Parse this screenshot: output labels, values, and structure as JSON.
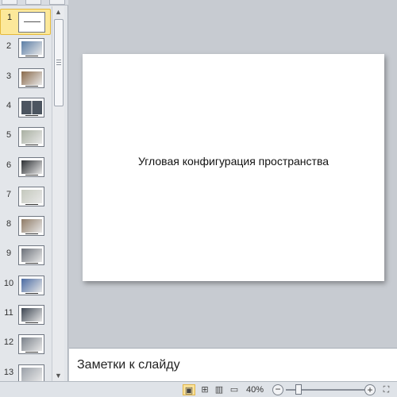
{
  "thumbnails": [
    {
      "number": "1",
      "selected": true,
      "kind": "title"
    },
    {
      "number": "2",
      "kind": "photo",
      "color": "#5c7ea6"
    },
    {
      "number": "3",
      "kind": "photo",
      "color": "#8a6a4c"
    },
    {
      "number": "4",
      "kind": "grid",
      "color": "#4c5560"
    },
    {
      "number": "5",
      "kind": "photo",
      "color": "#a9b0a2"
    },
    {
      "number": "6",
      "kind": "photo",
      "color": "#2c2f33"
    },
    {
      "number": "7",
      "kind": "photo",
      "color": "#c4c8bd"
    },
    {
      "number": "8",
      "kind": "photo",
      "color": "#8f7b66"
    },
    {
      "number": "9",
      "kind": "photo",
      "color": "#6b7079"
    },
    {
      "number": "10",
      "kind": "photo",
      "color": "#4a6aa2"
    },
    {
      "number": "11",
      "kind": "photo",
      "color": "#3d4652"
    },
    {
      "number": "12",
      "kind": "photo",
      "color": "#7a818a"
    },
    {
      "number": "13",
      "kind": "photo",
      "color": "#9aa0a8"
    }
  ],
  "slide": {
    "title": "Угловая конфигурация пространства"
  },
  "notes": {
    "placeholder": "Заметки к слайду"
  },
  "statusbar": {
    "zoom": "40%",
    "zoom_minus": "−",
    "zoom_plus": "+",
    "icons": {
      "normal_view": "normal-view-icon",
      "slide_sorter": "slide-sorter-icon",
      "reading_view": "reading-view-icon",
      "slide_show": "slide-show-icon",
      "fit_window": "fit-window-icon"
    }
  }
}
